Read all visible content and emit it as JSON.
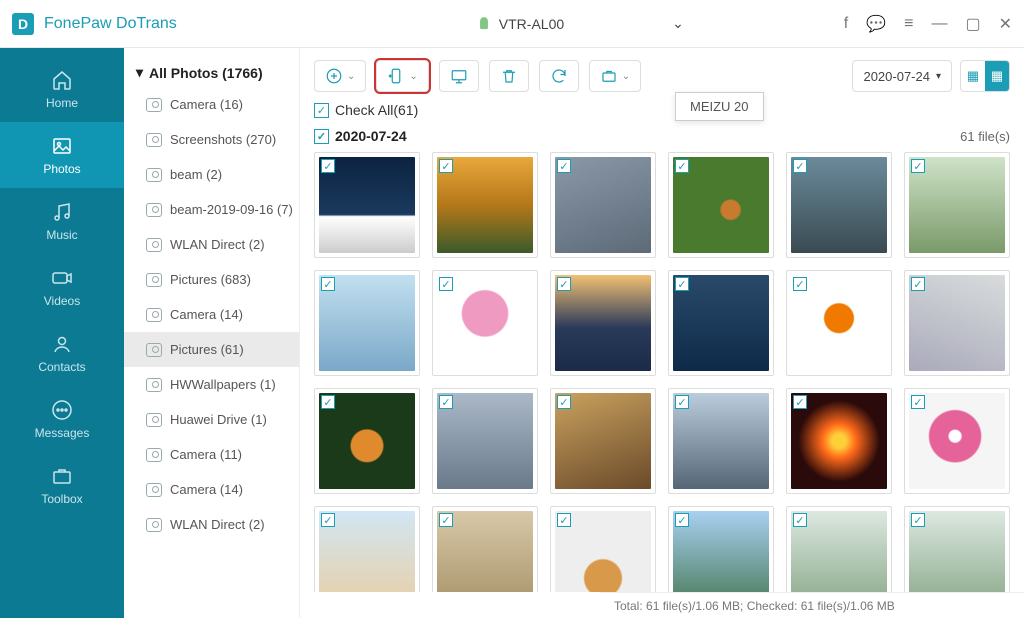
{
  "app": {
    "title": "FonePaw DoTrans"
  },
  "device": {
    "name": "VTR-AL00"
  },
  "tooltip": "MEIZU 20",
  "sidebar": [
    {
      "label": "Home",
      "icon": "home-icon"
    },
    {
      "label": "Photos",
      "icon": "photos-icon",
      "active": true
    },
    {
      "label": "Music",
      "icon": "music-icon"
    },
    {
      "label": "Videos",
      "icon": "videos-icon"
    },
    {
      "label": "Contacts",
      "icon": "contacts-icon"
    },
    {
      "label": "Messages",
      "icon": "messages-icon"
    },
    {
      "label": "Toolbox",
      "icon": "toolbox-icon"
    }
  ],
  "albums": {
    "header": "All Photos (1766)",
    "items": [
      "Camera (16)",
      "Screenshots (270)",
      "beam (2)",
      "beam-2019-09-16 (7)",
      "WLAN Direct (2)",
      "Pictures (683)",
      "Camera (14)",
      "Pictures (61)",
      "HWWallpapers (1)",
      "Huawei Drive (1)",
      "Camera (11)",
      "Camera (14)",
      "WLAN Direct (2)"
    ],
    "selected_index": 7
  },
  "toolbar": {
    "date": "2020-07-24"
  },
  "checkall": "Check All(61)",
  "date_group": {
    "label": "2020-07-24",
    "count": "61 file(s)"
  },
  "thumbs": [
    "linear-gradient(180deg,#0c2340,#1a3a5e 60%,#fff 62%,#ccc)",
    "linear-gradient(180deg,#e8a83c,#b57819 50%,#3a5a2a)",
    "linear-gradient(160deg,#8a98a8,#5d6a78)",
    "radial-gradient(circle at 60% 55%,#c97a2e 0 12%,#4a7a2e 14% 100%)",
    "linear-gradient(180deg,#6a8a9a,#3a4a52)",
    "linear-gradient(180deg,#cfe3c8,#7a9a6a)",
    "linear-gradient(180deg,#c2e0f0,#7aa8c8)",
    "radial-gradient(circle at 50% 40%,#ef9ac0 0 30%,#fff 32% 100%)",
    "linear-gradient(180deg,#f2c073,#2a3a5a 55%,#1a2a48)",
    "linear-gradient(180deg,#2a4a6a,#0e2a48)",
    "radial-gradient(circle at 50% 45%,#f07a00 0 20%,#fff 22% 100%)",
    "linear-gradient(200deg,#d8dcdc,#aab)",
    "radial-gradient(circle at 50% 55%,#e08a2e 0 22%,#1a3a1a 24% 100%)",
    "linear-gradient(180deg,#aab8c8,#6a7a8a)",
    "linear-gradient(160deg,#c9a15e,#6a4a2a)",
    "linear-gradient(180deg,#bcd,#567)",
    "radial-gradient(circle at 50% 50%,#ffcf3a 0 10%,#ff6a1a 25%,#2a0a0a 60%)",
    "radial-gradient(circle at 48% 45%,#fff 0 8%,#e6639a 10% 35%,#f5f5f5 37% 100%)",
    "linear-gradient(180deg,#d2e6f4,#e8cfa6)",
    "linear-gradient(180deg,#d8c8a8,#a8946a)",
    "radial-gradient(circle at 50% 70%,#d89a4a 0 22%,#eee 24% 100%)",
    "linear-gradient(180deg,#a8d0f0,#4a7a5a)",
    "linear-gradient(180deg,#dce8e0,#8aa88a)",
    "linear-gradient(180deg,#dce8e0,#8aa88a)"
  ],
  "status": "Total: 61 file(s)/1.06 MB; Checked: 61 file(s)/1.06 MB"
}
